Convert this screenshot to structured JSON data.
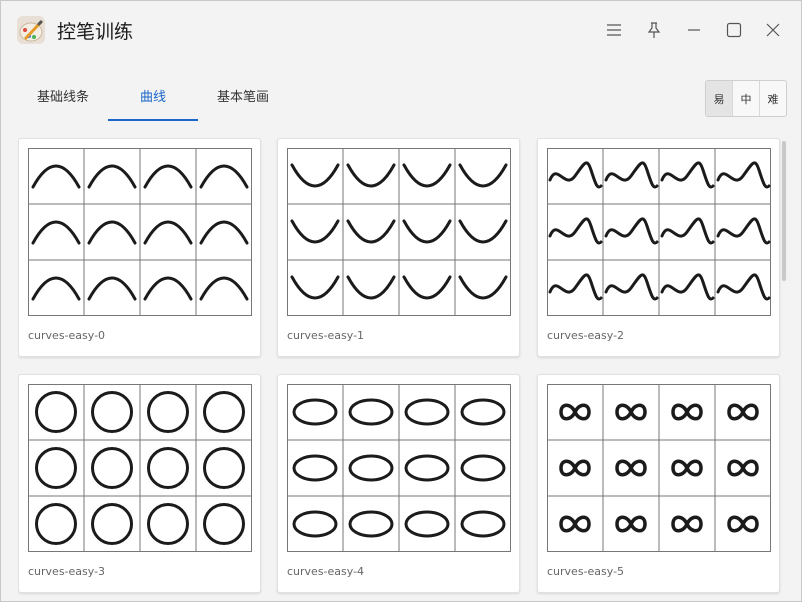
{
  "app": {
    "title": "控笔训练",
    "icon": "pencil-palette-icon"
  },
  "window_controls": {
    "menu_icon": "hamburger-menu-icon",
    "pin_icon": "pin-icon",
    "minimize_icon": "minimize-icon",
    "maximize_icon": "maximize-icon",
    "close_icon": "close-icon"
  },
  "tabs": [
    {
      "label": "基础线条",
      "active": false
    },
    {
      "label": "曲线",
      "active": true
    },
    {
      "label": "基本笔画",
      "active": false
    }
  ],
  "difficulty": [
    {
      "label": "易",
      "active": true
    },
    {
      "label": "中",
      "active": false
    },
    {
      "label": "难",
      "active": false
    }
  ],
  "cards": [
    {
      "label": "curves-easy-0",
      "shape": "arch"
    },
    {
      "label": "curves-easy-1",
      "shape": "u-curve"
    },
    {
      "label": "curves-easy-2",
      "shape": "wave"
    },
    {
      "label": "curves-easy-3",
      "shape": "circle"
    },
    {
      "label": "curves-easy-4",
      "shape": "ellipse"
    },
    {
      "label": "curves-easy-5",
      "shape": "infinity"
    }
  ],
  "colors": {
    "accent": "#1a66c9",
    "stroke": "#1b1b1b"
  }
}
